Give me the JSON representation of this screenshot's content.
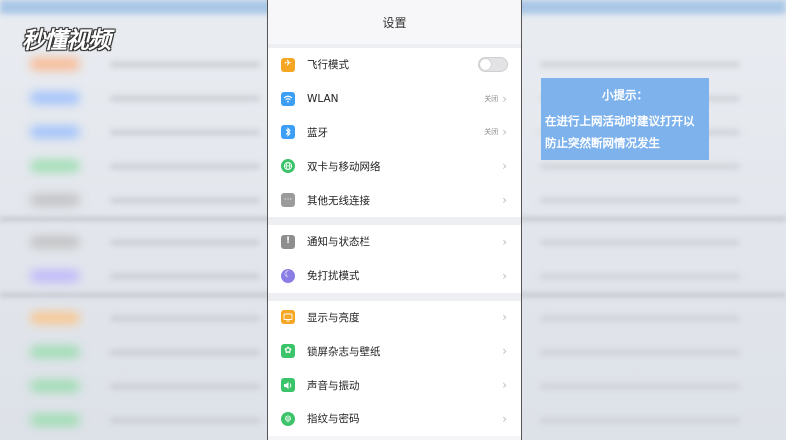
{
  "logo": {
    "text": "秒懂视频"
  },
  "panel": {
    "title": "设置",
    "groups": [
      {
        "items": [
          {
            "label": "飞行模式",
            "icon": "airplane-icon",
            "color": "#f5a623",
            "control": "toggle",
            "toggle_on": false
          },
          {
            "label": "WLAN",
            "icon": "wifi-icon",
            "color": "#3d9ef5",
            "status": "关闭"
          },
          {
            "label": "蓝牙",
            "icon": "bluetooth-icon",
            "color": "#3d9ef5",
            "status": "关闭"
          },
          {
            "label": "双卡与移动网络",
            "icon": "globe-icon",
            "color": "#3cc46a"
          },
          {
            "label": "其他无线连接",
            "icon": "more-icon",
            "color": "#9b9b9b"
          }
        ]
      },
      {
        "items": [
          {
            "label": "通知与状态栏",
            "icon": "notification-icon",
            "color": "#8e8e8e"
          },
          {
            "label": "免打扰模式",
            "icon": "moon-icon",
            "color": "#8a7de6"
          }
        ]
      },
      {
        "items": [
          {
            "label": "显示与亮度",
            "icon": "display-icon",
            "color": "#f5a623"
          },
          {
            "label": "锁屏杂志与壁纸",
            "icon": "flower-icon",
            "color": "#3cc46a"
          },
          {
            "label": "声音与振动",
            "icon": "speaker-icon",
            "color": "#3cc46a"
          },
          {
            "label": "指纹与密码",
            "icon": "fingerprint-icon",
            "color": "#3cc46a"
          }
        ]
      }
    ]
  },
  "tip": {
    "title": "小提示：",
    "line1": "在进行上网活动时建议打开以",
    "line2": "防止突然断网情况发生"
  }
}
